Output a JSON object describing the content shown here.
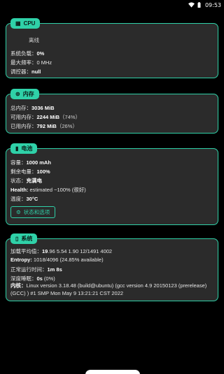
{
  "statusbar": {
    "time": "09:53"
  },
  "cpu": {
    "title": "CPU",
    "state": "离线",
    "rows": [
      {
        "label": "系统负载：",
        "value": "0%"
      },
      {
        "label": "最大频率：",
        "value": "0 MHz"
      },
      {
        "label": "调控器：",
        "value": "null"
      }
    ]
  },
  "memory": {
    "title": "内存",
    "rows": [
      {
        "label": "总内存：",
        "value": "3036 MiB",
        "extra": ""
      },
      {
        "label": "可用内存：",
        "value": "2244 MiB",
        "extra": "（74%）"
      },
      {
        "label": "已用内存：",
        "value": "792 MiB",
        "extra": "（26%）"
      }
    ]
  },
  "battery": {
    "title": "电池",
    "rows": [
      {
        "label": "容量：",
        "value": "1000 mAh"
      },
      {
        "label": "剩余电量：",
        "value": "100%"
      },
      {
        "label": "状态：",
        "value": "充满电"
      },
      {
        "label": "Health:",
        "value": " estimated ~100% (很好)"
      },
      {
        "label": "温度：",
        "value": "30°C"
      }
    ],
    "button_label": "状态和选项"
  },
  "system": {
    "title": "系统",
    "rows": [
      {
        "label": "加载平均值：",
        "value_bold": "19",
        "value": ".96 5.54 1.90 12/1491 4002"
      },
      {
        "label": "Entropy:",
        "value_bold": "",
        "value": " 1018/4096 (24.85% available)"
      },
      {
        "label": "正常运行时间：",
        "value_bold": "",
        "value": "1m 8s"
      },
      {
        "label": "深度睡眠：",
        "value_bold": "0s",
        "value": " (0%)"
      }
    ],
    "kernel_label": "内核：",
    "kernel_value": "Linux version 3.18.48 (build@ubuntu) (gcc version 4.9 20150123 (prerelease) (GCC) ) #1 SMP Mon May 9 13:21:21 CST 2022"
  }
}
